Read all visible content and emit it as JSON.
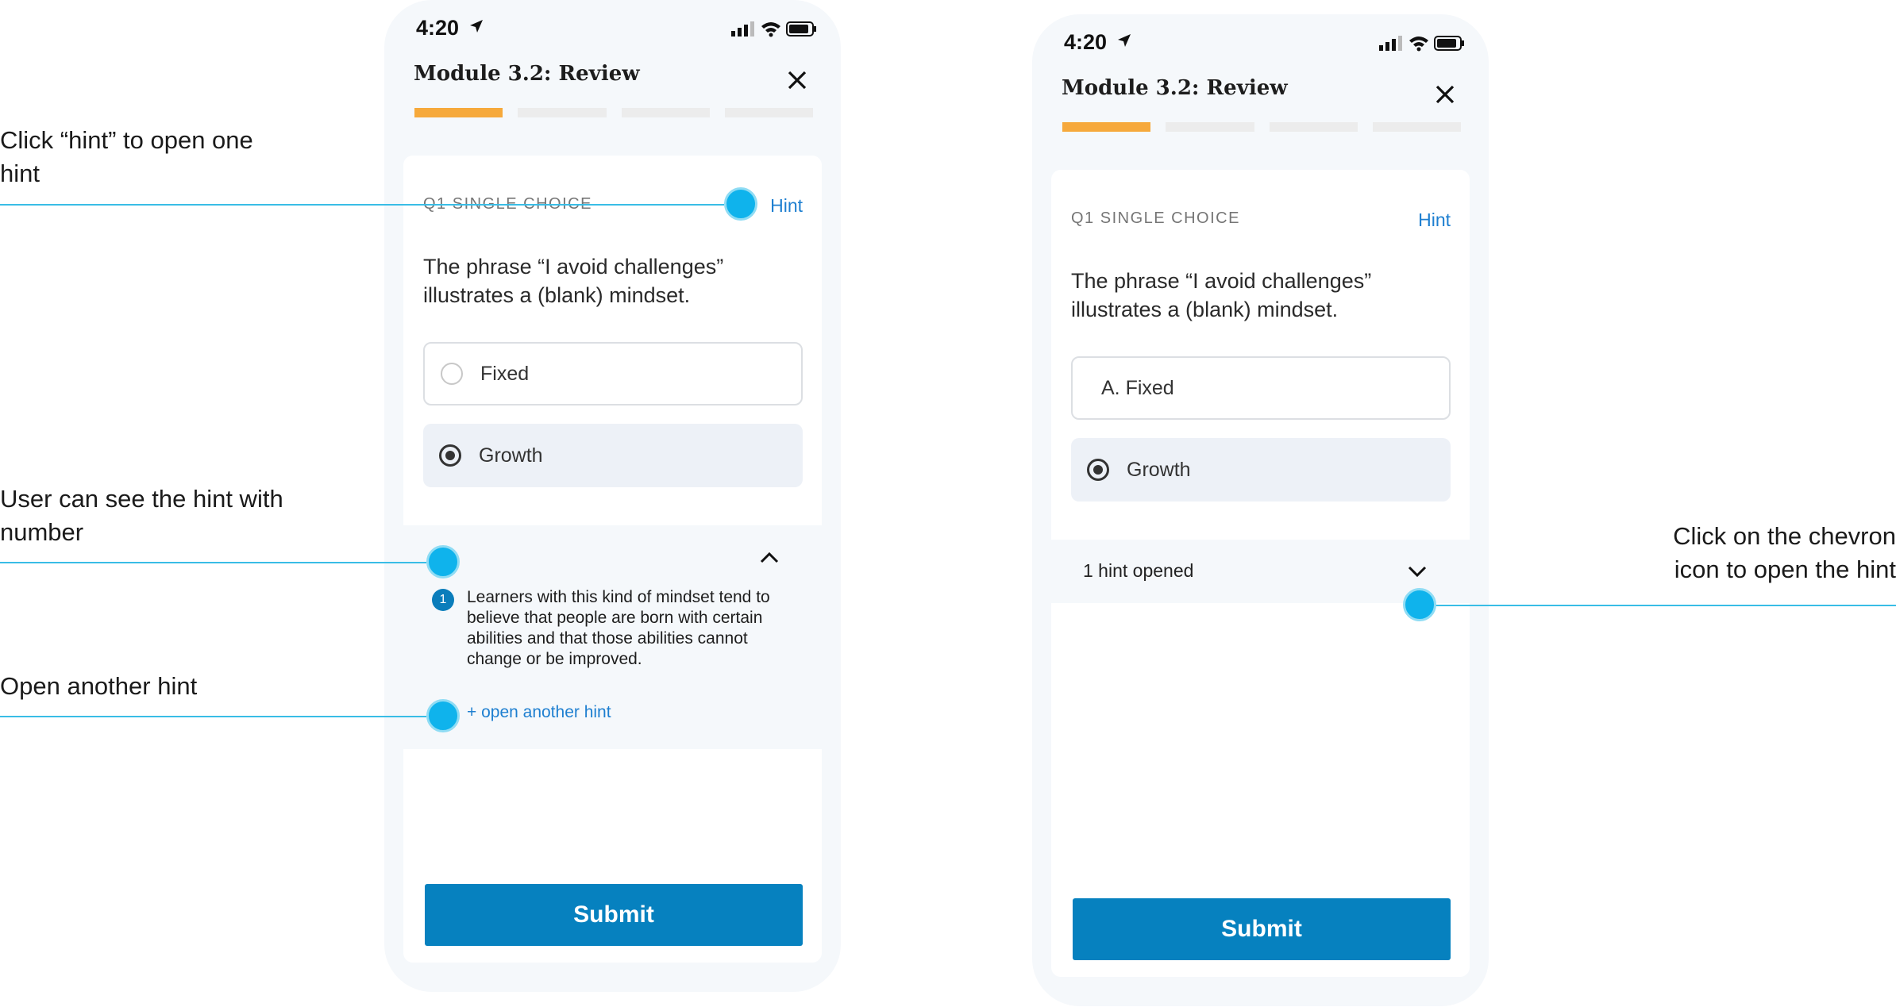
{
  "annotations": {
    "hint_click": "Click “hint” to open one hint",
    "see_hint": "User can see the hint with number",
    "open_another": "Open another hint",
    "chevron": "Click on the chevron icon to open the hint"
  },
  "screen1": {
    "time": "4:20",
    "title": "Module 3.2: Review",
    "progress_done": 1,
    "progress_total": 4,
    "question_label": "Q1 SINGLE CHOICE",
    "hint_link": "Hint",
    "question": "The phrase “I avoid challenges” illustrates a (blank) mindset.",
    "options": [
      "Fixed",
      "Growth"
    ],
    "selected_option": "Growth",
    "hint_number": "1",
    "hint_text": "Learners with this kind of mindset tend to believe that people are born with certain abilities and that those abilities cannot change or be improved.",
    "open_another_hint": "+ open another hint",
    "submit": "Submit"
  },
  "screen2": {
    "time": "4:20",
    "title": "Module 3.2: Review",
    "progress_done": 1,
    "progress_total": 4,
    "question_label": "Q1 SINGLE CHOICE",
    "hint_link": "Hint",
    "question": "The phrase “I avoid challenges” illustrates a (blank) mindset.",
    "options": [
      "A. Fixed",
      "Growth"
    ],
    "selected_option": "Growth",
    "hints_opened": "1 hint opened",
    "submit": "Submit"
  },
  "colors": {
    "accent": "#0681bf",
    "link": "#1e7fd0",
    "progress": "#f6a93b",
    "callout": "#39bde6"
  }
}
